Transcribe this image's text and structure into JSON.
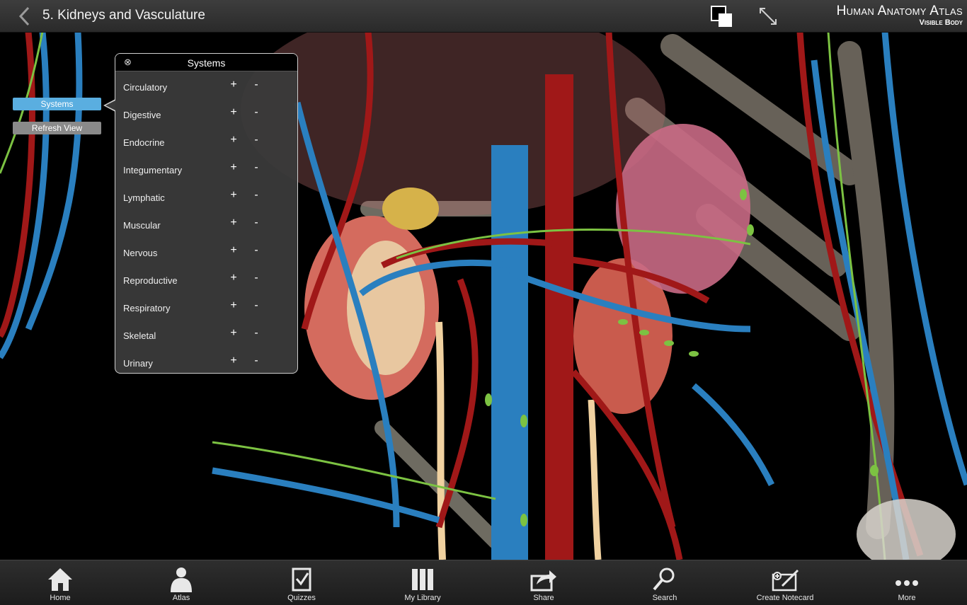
{
  "header": {
    "title": "5. Kidneys and Vasculature",
    "brand_title": "Human Anatomy Atlas",
    "brand_sub": "Visible Body"
  },
  "left_buttons": {
    "systems": "Systems",
    "refresh": "Refresh View"
  },
  "panel": {
    "title": "Systems",
    "close_glyph": "⊗",
    "plus": "+",
    "minus": "-",
    "items": [
      {
        "label": "Circulatory"
      },
      {
        "label": "Digestive"
      },
      {
        "label": "Endocrine"
      },
      {
        "label": "Integumentary"
      },
      {
        "label": "Lymphatic"
      },
      {
        "label": "Muscular"
      },
      {
        "label": "Nervous"
      },
      {
        "label": "Reproductive"
      },
      {
        "label": "Respiratory"
      },
      {
        "label": "Skeletal"
      },
      {
        "label": "Urinary"
      }
    ]
  },
  "toolbar": {
    "items": [
      {
        "label": "Home",
        "icon": "home-icon"
      },
      {
        "label": "Atlas",
        "icon": "atlas-icon"
      },
      {
        "label": "Quizzes",
        "icon": "quizzes-icon"
      },
      {
        "label": "My Library",
        "icon": "library-icon"
      },
      {
        "label": "Share",
        "icon": "share-icon"
      },
      {
        "label": "Search",
        "icon": "search-icon"
      },
      {
        "label": "Create Notecard",
        "icon": "notecard-icon"
      },
      {
        "label": "More",
        "icon": "more-icon"
      }
    ]
  },
  "colors": {
    "accent": "#5aaee0",
    "artery": "#a01818",
    "vein": "#2a7fbf",
    "lymph": "#7cc242",
    "kidney": "#d46b5e",
    "bone": "#c9c2b0"
  }
}
